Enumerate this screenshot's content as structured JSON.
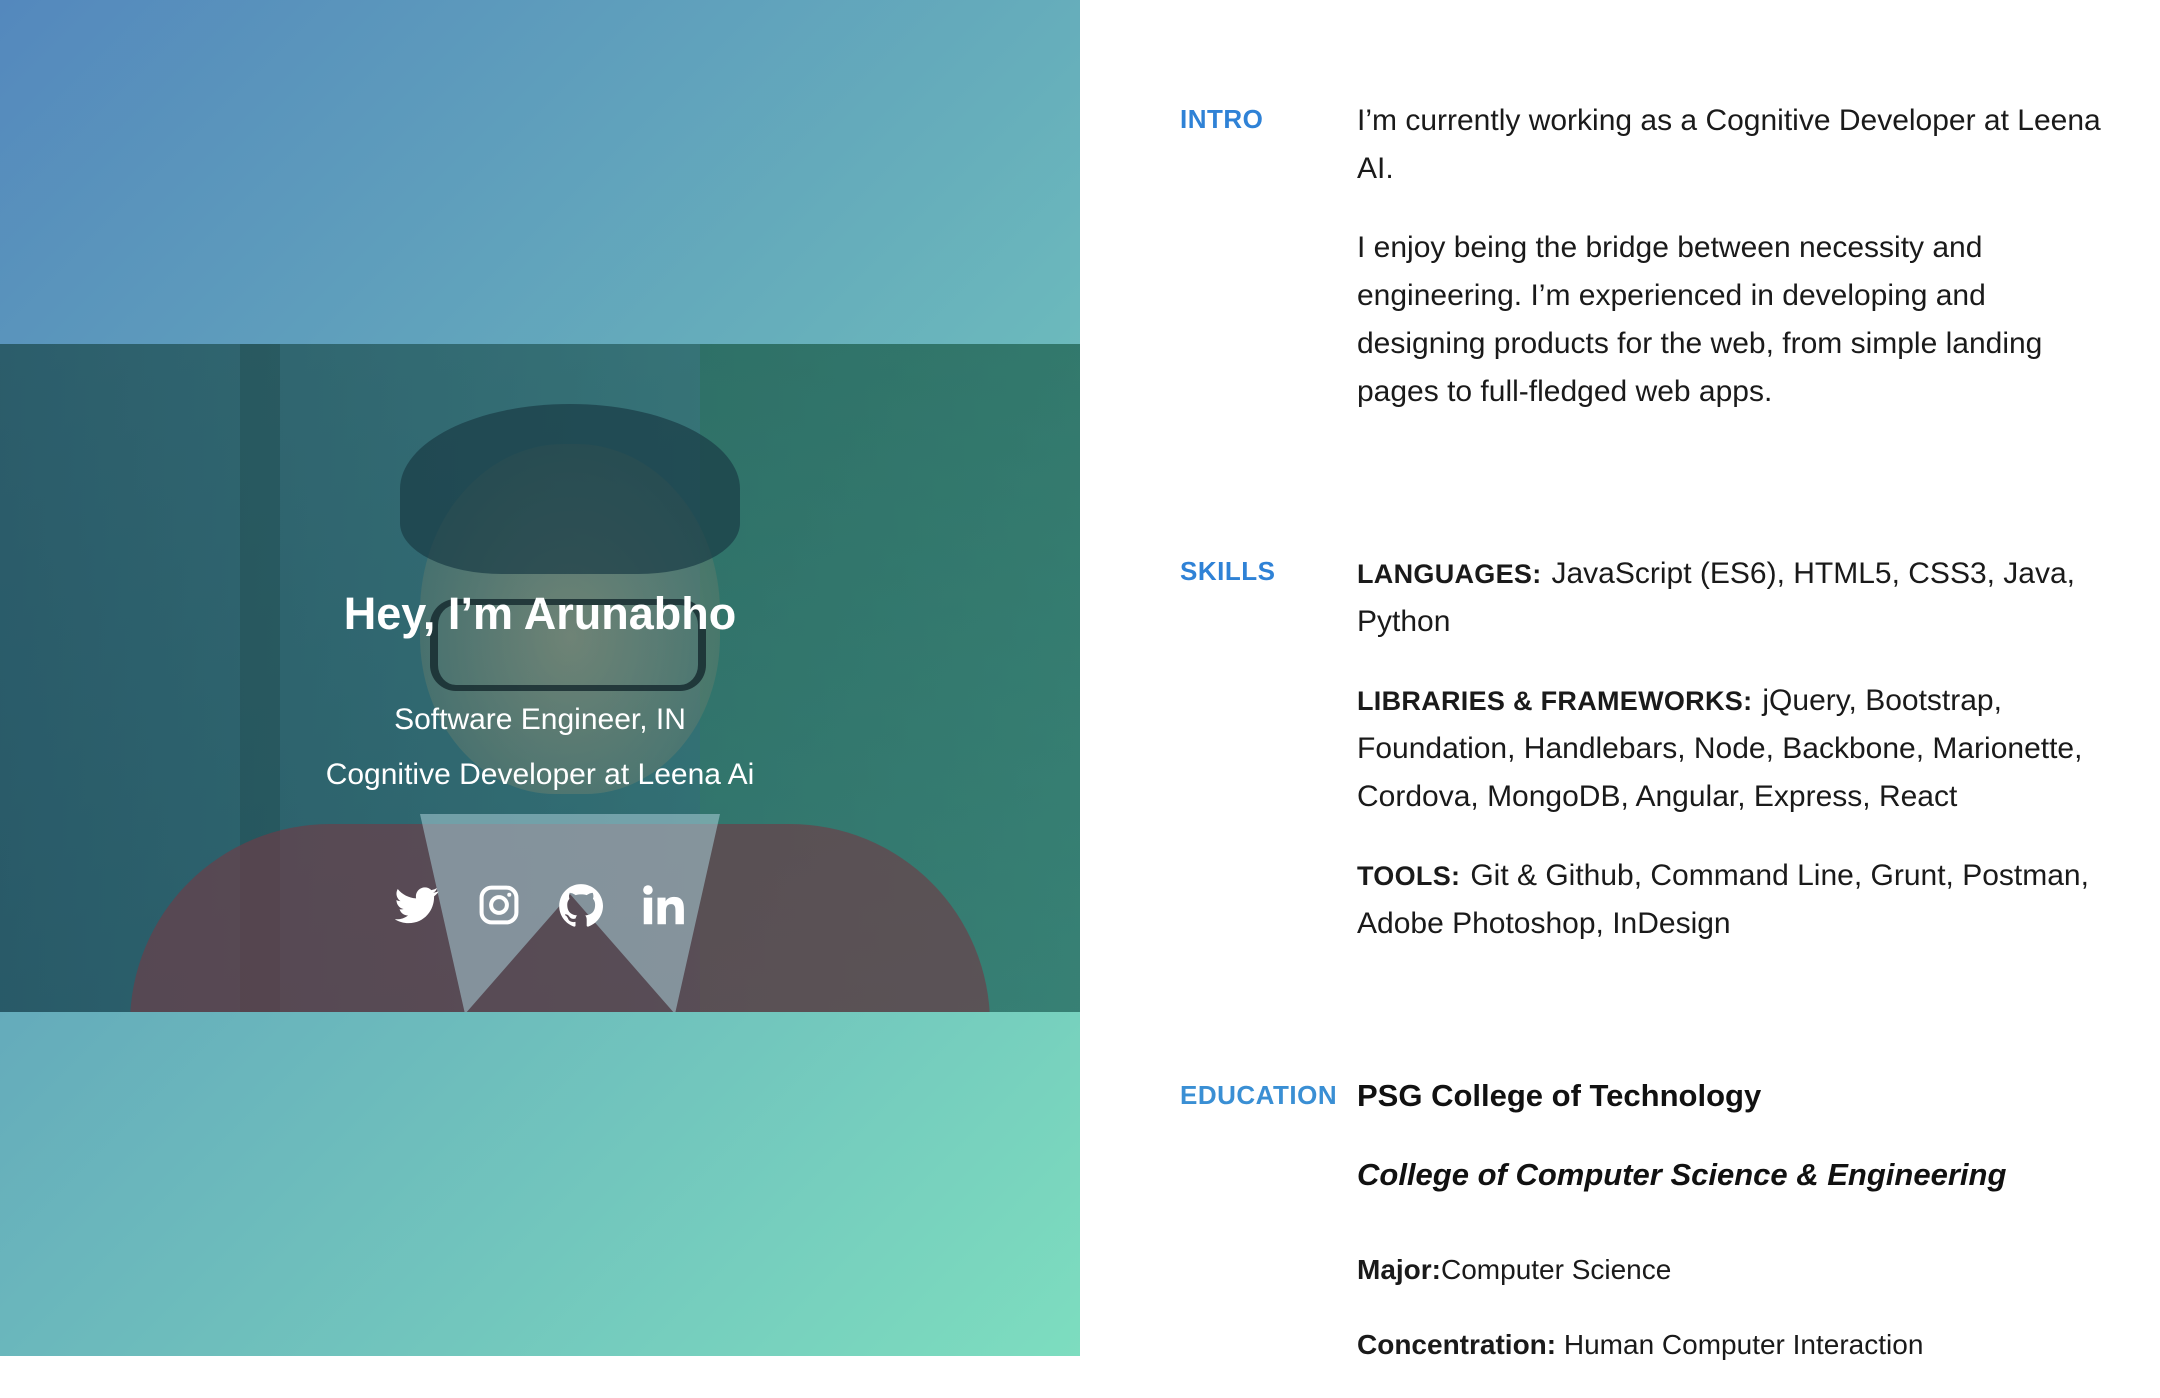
{
  "hero": {
    "title": "Hey, I’m Arunabho",
    "subtitle_1": "Software Engineer, IN",
    "subtitle_2": "Cognitive Developer at Leena Ai",
    "social_icons": [
      "twitter-icon",
      "instagram-icon",
      "github-icon",
      "linkedin-icon"
    ]
  },
  "intro": {
    "label": "INTRO",
    "paragraph_1": "I’m currently working as a Cognitive Developer at Leena AI.",
    "paragraph_2": "I enjoy being the bridge between necessity and engineering. I’m experienced in developing and designing products for the web, from simple landing pages to full-fledged web apps."
  },
  "skills": {
    "label": "SKILLS",
    "languages_label": "LANGUAGES:",
    "languages_value": "JavaScript (ES6), HTML5, CSS3, Java, Python",
    "libraries_label": "LIBRARIES & FRAMEWORKS:",
    "libraries_value": "jQuery, Bootstrap, Foundation, Handlebars, Node, Backbone, Marionette, Cordova, MongoDB, Angular, Express, React",
    "tools_label": "TOOLS:",
    "tools_value": "Git & Github, Command Line, Grunt, Postman, Adobe Photoshop, InDesign"
  },
  "education": {
    "label": "EDUCATION",
    "school": "PSG College of Technology",
    "college": "College of Computer Science & Engineering",
    "major_label": "Major:",
    "major_value": "Computer Science",
    "concentration_label": "Concentration:",
    "concentration_value": "Human Computer Interaction"
  },
  "colors": {
    "accent": "#2f82d6",
    "hero_gradient_start": "#5488bd",
    "hero_gradient_end": "#7dddbf",
    "text": "#1a1a1a"
  }
}
